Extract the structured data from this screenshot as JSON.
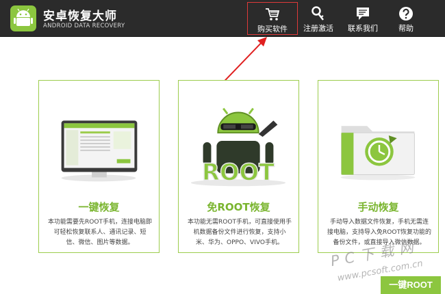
{
  "app": {
    "title": "安卓恢复大师",
    "subtitle": "ANDROID DATA RECOVERY"
  },
  "nav": {
    "buy": {
      "label": "购买软件",
      "icon": "cart-icon"
    },
    "register": {
      "label": "注册激活",
      "icon": "key-icon"
    },
    "contact": {
      "label": "联系我们",
      "icon": "chat-icon"
    },
    "help": {
      "label": "帮助",
      "icon": "help-icon"
    }
  },
  "cards": [
    {
      "title": "一键恢复",
      "description": "本功能需要先ROOT手机，连接电脑即可轻松恢复联系人、通讯记录、短信、微信、图片等数据。",
      "image": "computer-screen-icon"
    },
    {
      "title": "免ROOT恢复",
      "image_text": "ROOT",
      "description": "本功能无需ROOT手机，可直接使用手机数据备份文件进行恢复，支持小米、华为、OPPO、VIVO手机。",
      "image": "android-robot-icon"
    },
    {
      "title": "手动恢复",
      "description": "手动导入数据文件恢复，手机无需连接电脑，支持导入免ROOT恢复功能的备份文件，或直接导入微信数据。",
      "image": "restore-folder-icon"
    }
  ],
  "bottom_button": {
    "label": "一键ROOT"
  },
  "watermark": {
    "main": "PC下载网",
    "url": "www.pcsoft.com.cn"
  },
  "colors": {
    "accent": "#8cc63f",
    "header": "#2b2b2b",
    "highlight": "#e03a3a"
  }
}
